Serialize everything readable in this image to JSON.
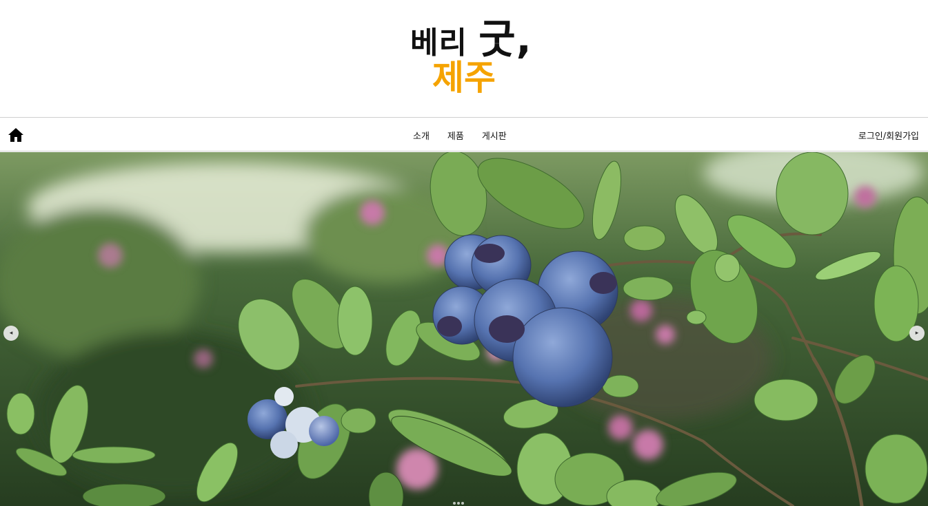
{
  "header": {
    "logo": {
      "line1_part1": "베리",
      "line1_part2": "굿,",
      "line2": "제주"
    }
  },
  "nav": {
    "home_icon": "home-icon",
    "items": [
      {
        "label": "소개"
      },
      {
        "label": "제품"
      },
      {
        "label": "게시판"
      }
    ],
    "auth_label": "로그인/회원가입"
  },
  "slider": {
    "prev_symbol": "◂",
    "next_symbol": "▸",
    "slide_subject": "blueberry-bush-photo",
    "dot_count": 3
  },
  "colors": {
    "brand_orange": "#f5a300",
    "logo_dark": "#111111",
    "nav_border": "#cfcfcf"
  }
}
